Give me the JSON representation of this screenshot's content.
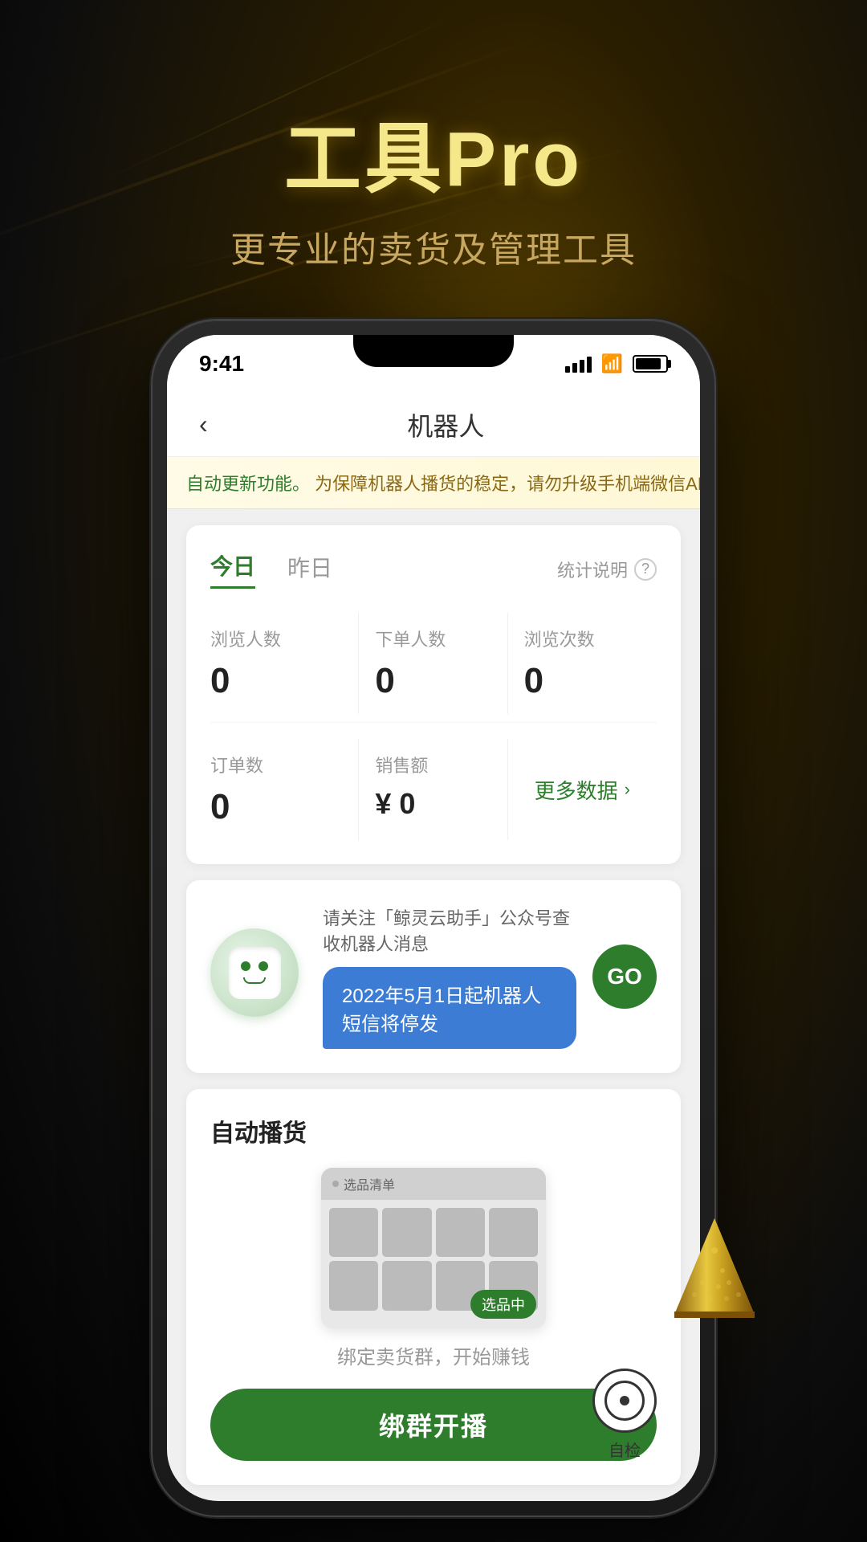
{
  "background": {
    "gradient": "dark-gold"
  },
  "header": {
    "main_title": "工具Pro",
    "sub_title": "更专业的卖货及管理工具"
  },
  "phone": {
    "status_bar": {
      "time": "9:41"
    },
    "nav": {
      "title": "机器人",
      "back_label": "‹"
    },
    "warning": {
      "prefix": "自动更新功能。",
      "text": "为保障机器人播货的稳定，请勿升级手机端微信APP"
    },
    "stats": {
      "tab_today": "今日",
      "tab_yesterday": "昨日",
      "stats_help": "统计说明",
      "visitors_label": "浏览人数",
      "visitors_value": "0",
      "orders_placed_label": "下单人数",
      "orders_placed_value": "0",
      "views_label": "浏览次数",
      "views_value": "0",
      "orders_label": "订单数",
      "orders_value": "0",
      "sales_label": "销售额",
      "sales_value": "¥ 0",
      "more_data": "更多数据"
    },
    "notification": {
      "title": "请关注「鲸灵云助手」公众号查收机器人消息",
      "message": "2022年5月1日起机器人短信将停发",
      "go_btn": "GO"
    },
    "broadcast": {
      "section_title": "自动播货",
      "badge_text": "选品中",
      "desc": "绑定卖货群，开始赚钱",
      "bind_btn": "绑群开播",
      "self_check": "自检"
    }
  }
}
